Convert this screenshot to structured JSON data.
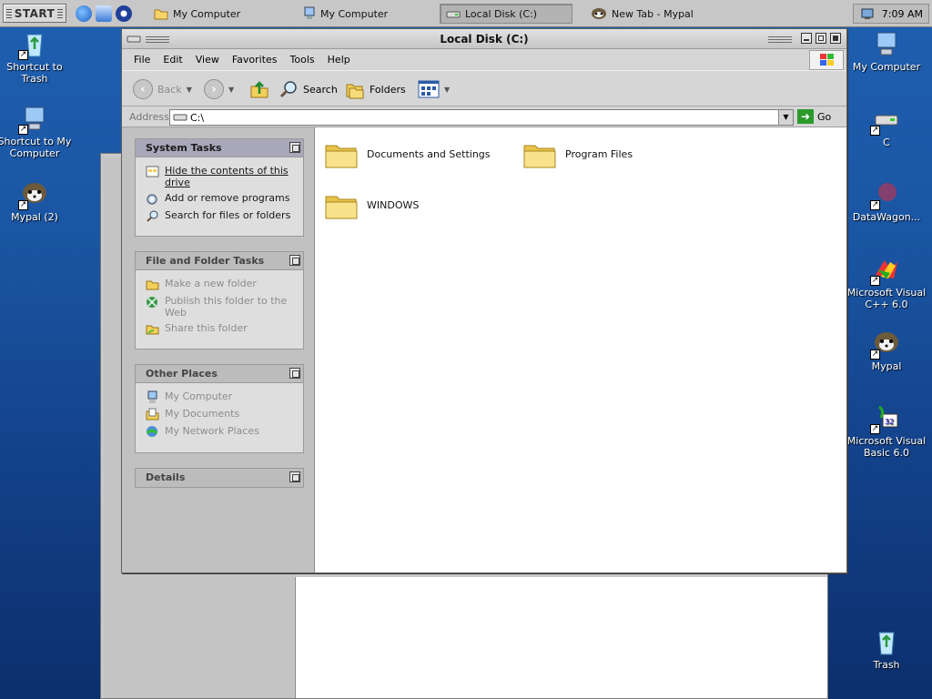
{
  "taskbar": {
    "start_label": "START",
    "tasks": [
      {
        "label": "My Computer",
        "icon": "folder-icon"
      },
      {
        "label": "My Computer",
        "icon": "my-computer-icon"
      },
      {
        "label": "Local Disk (C:)",
        "icon": "drive-icon",
        "active": true
      },
      {
        "label": "New Tab - Mypal",
        "icon": "mypal-icon"
      }
    ],
    "clock": "7:09 AM"
  },
  "desktop": {
    "left_icons": [
      {
        "label": "Shortcut to Trash",
        "icon": "recycle-icon"
      },
      {
        "label": "Shortcut to My Computer",
        "icon": "computer-icon"
      },
      {
        "label": "Mypal (2)",
        "icon": "mypal-icon"
      }
    ],
    "right_icons": [
      {
        "label": "My Computer",
        "icon": "computer-icon"
      },
      {
        "label": "C",
        "icon": "drive-icon"
      },
      {
        "label": "DataWagon...",
        "icon": "datawagon-icon"
      },
      {
        "label": "Microsoft Visual C++ 6.0",
        "icon": "visual-cpp-icon"
      },
      {
        "label": "Mypal",
        "icon": "mypal-icon"
      },
      {
        "label": "Microsoft Visual Basic 6.0",
        "icon": "visual-basic-icon"
      },
      {
        "label": "Trash",
        "icon": "recycle-icon"
      }
    ]
  },
  "window": {
    "title": "Local Disk (C:)",
    "menu": [
      "File",
      "Edit",
      "View",
      "Favorites",
      "Tools",
      "Help"
    ],
    "toolbar": {
      "back": "Back",
      "search": "Search",
      "folders": "Folders"
    },
    "address": {
      "label": "Address",
      "value": "C:\\",
      "go": "Go"
    },
    "panels": {
      "system_tasks": {
        "title": "System Tasks",
        "items": [
          "Hide the contents of this drive",
          "Add or remove programs",
          "Search for files or folders"
        ]
      },
      "file_tasks": {
        "title": "File and Folder Tasks",
        "items": [
          "Make a new folder",
          "Publish this folder to the Web",
          "Share this folder"
        ]
      },
      "other_places": {
        "title": "Other Places",
        "items": [
          "My Computer",
          "My Documents",
          "My Network Places"
        ]
      },
      "details": {
        "title": "Details"
      }
    },
    "folders": [
      "Documents and Settings",
      "Program Files",
      "WINDOWS"
    ]
  }
}
